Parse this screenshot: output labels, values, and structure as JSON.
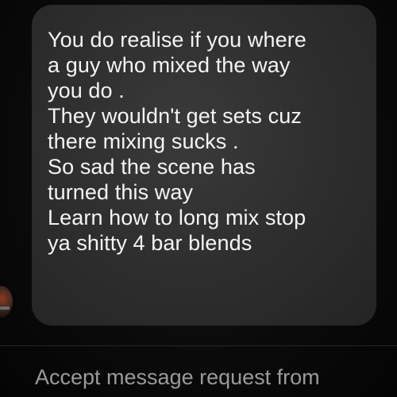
{
  "conversation": {
    "message": {
      "lines": [
        "You do realise if you where",
        "a guy who mixed the way",
        "you do .",
        "They wouldn't get sets cuz",
        "there mixing sucks .",
        "So sad the scene has",
        "turned this way",
        "Learn how to long mix stop",
        "ya shitty 4 bar blends"
      ]
    },
    "sender_avatar": {
      "icon": "profile-photo"
    }
  },
  "footer": {
    "request_label": "Accept message request from"
  }
}
